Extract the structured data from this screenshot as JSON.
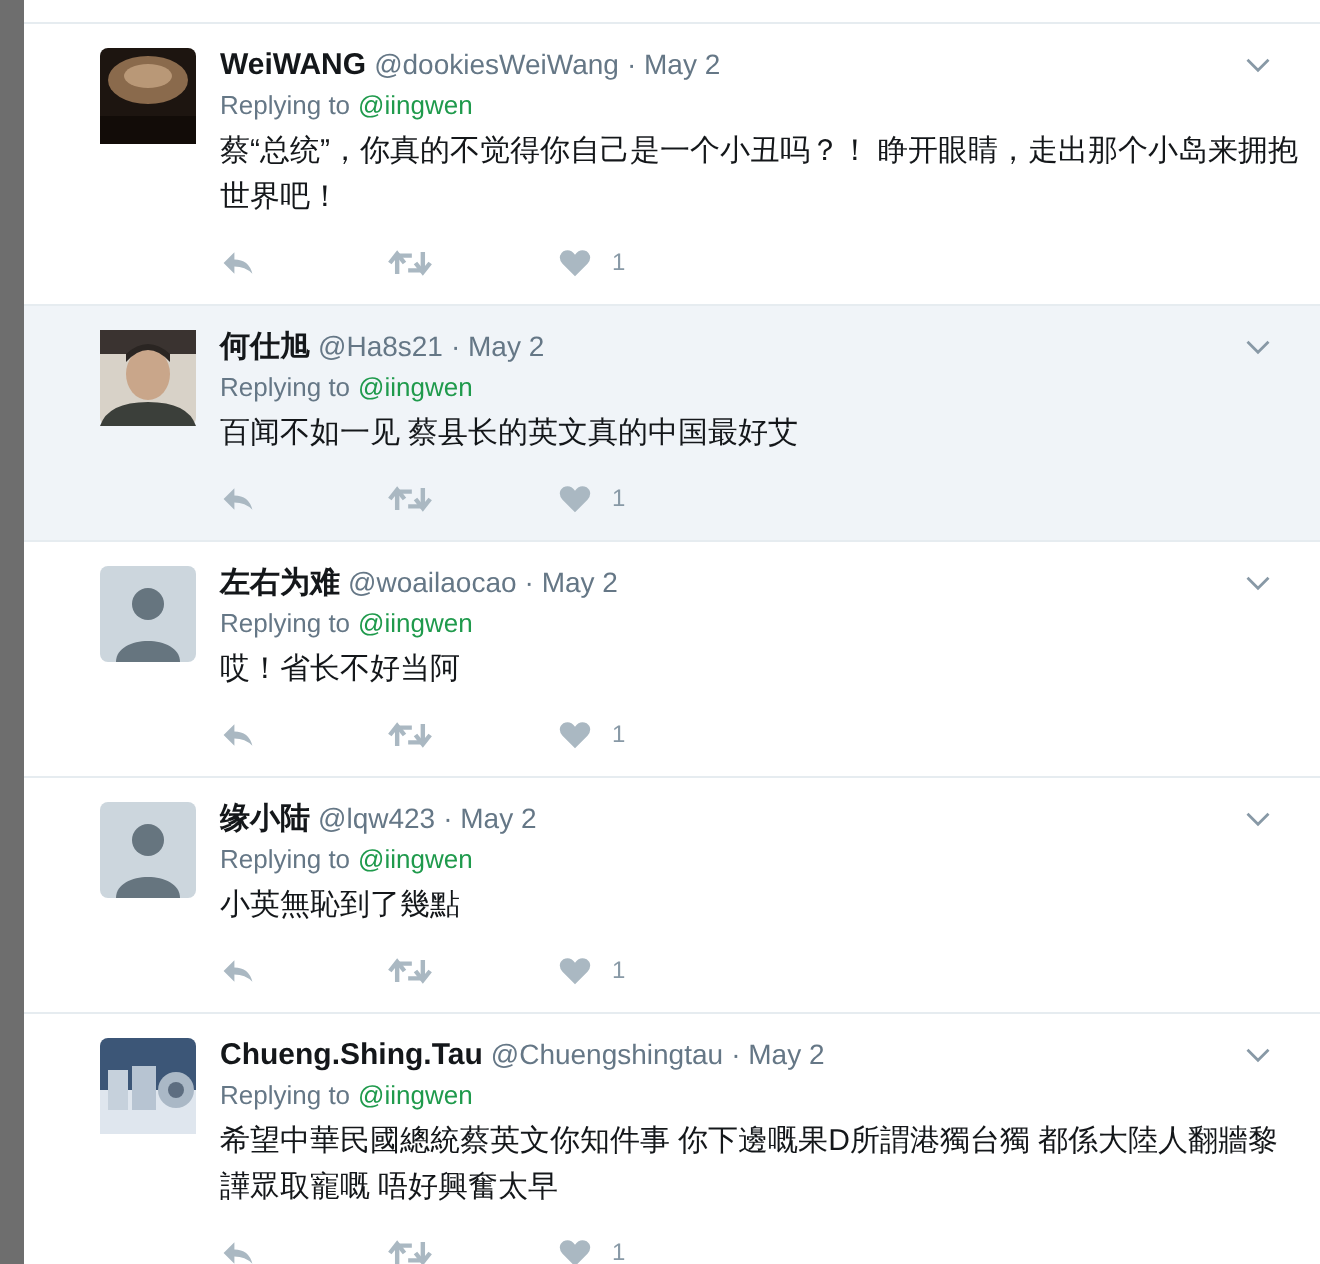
{
  "tweets": [
    {
      "name": "WeiWANG",
      "handle": "@dookiesWeiWang",
      "date": "· May 2",
      "replying_label": "Replying to",
      "reply_to": "@iingwen",
      "text": "蔡“总统”，你真的不觉得你自己是一个小丑吗？！ 睁开眼睛，走出那个小岛来拥抱世界吧！",
      "likes": "1",
      "highlighted": false
    },
    {
      "name": "何仕旭",
      "handle": "@Ha8s21",
      "date": "· May 2",
      "replying_label": "Replying to",
      "reply_to": "@iingwen",
      "text": "百闻不如一见 蔡县长的英文真的中国最好艾",
      "likes": "1",
      "highlighted": true,
      "avatar": {
        "kind": "person"
      }
    },
    {
      "name": "左右为难",
      "handle": "@woailaocao",
      "date": "· May 2",
      "replying_label": "Replying to",
      "reply_to": "@iingwen",
      "text": "哎！省长不好当阿",
      "likes": "1",
      "highlighted": false,
      "avatar": {
        "kind": "default"
      }
    },
    {
      "name": "缘小陆",
      "handle": "@lqw423",
      "date": "· May 2",
      "replying_label": "Replying to",
      "reply_to": "@iingwen",
      "text": "小英無恥到了幾點",
      "likes": "1",
      "highlighted": false,
      "avatar": {
        "kind": "default"
      }
    },
    {
      "name": "Chueng.Shing.Tau",
      "handle": "@Chuengshingtau",
      "date": "· May 2",
      "replying_label": "Replying to",
      "reply_to": "@iingwen",
      "text": "希望中華民國總統蔡英文你知件事 你下邊嘅果D所謂港獨台獨 都係大陸人翻牆黎譁眾取寵嘅 唔好興奮太早",
      "likes": "1",
      "highlighted": false
    }
  ]
}
